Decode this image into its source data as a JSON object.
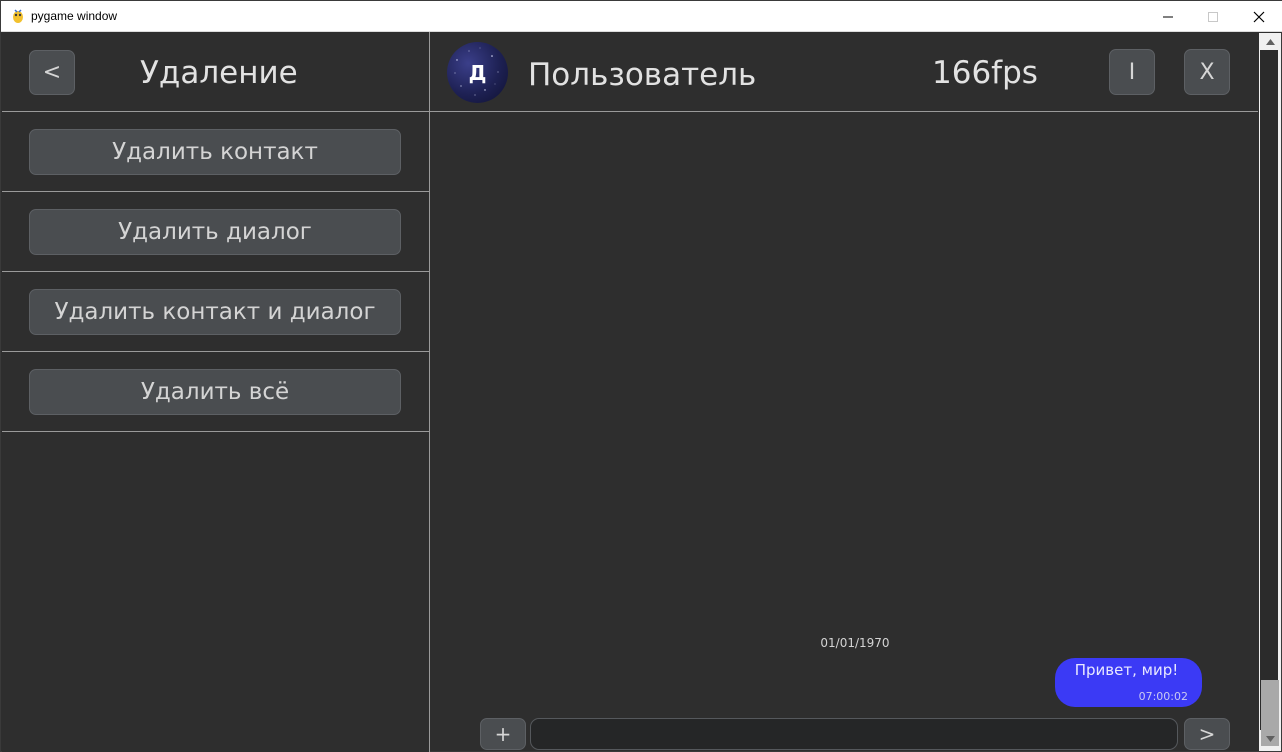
{
  "window": {
    "title": "pygame window",
    "minimize_glyph": "—",
    "maximize_glyph": "☐",
    "close_glyph": "✕"
  },
  "left_panel": {
    "back_label": "<",
    "title": "Удаление",
    "menu": [
      {
        "label": "Удалить контакт"
      },
      {
        "label": "Удалить диалог"
      },
      {
        "label": "Удалить контакт и диалог"
      },
      {
        "label": "Удалить всё"
      }
    ]
  },
  "chat": {
    "avatar_letter": "Д",
    "name": "Пользователь",
    "fps": "166fps",
    "info_label": "I",
    "close_label": "X",
    "date": "01/01/1970",
    "messages": [
      {
        "text": "Привет, мир!",
        "time": "07:00:02",
        "color": "#3b3af5"
      }
    ],
    "attach_label": "+",
    "input_value": "",
    "send_label": ">"
  },
  "colors": {
    "background": "#2e2e2e",
    "button": "#4a4d50",
    "accent": "#3b3af5"
  }
}
